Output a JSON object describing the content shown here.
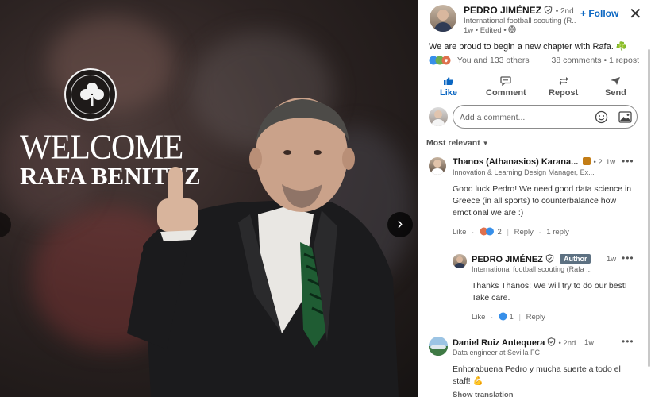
{
  "image": {
    "crest_text": "ΠΑΝΑΘΗΝΑΪΚΟΣ 1908",
    "welcome_text": "WELCOME",
    "name_text": "RAFA BENITEZ",
    "next_icon": "chevron-right-icon",
    "colors": {
      "club_green": "#1f5c33",
      "background": "#2a2221"
    }
  },
  "post": {
    "author": {
      "name": "PEDRO JIMÉNEZ",
      "degree": "• 2nd",
      "headline": "International football scouting (R...",
      "meta": "1w • Edited •"
    },
    "follow_label": "+ Follow",
    "close_icon": "close-icon",
    "text": "We are proud to begin a new chapter with Rafa. ☘️",
    "reactions_label": "You and 133 others",
    "comments_label": "38 comments",
    "reposts_label": "1 repost",
    "actions": {
      "like": "Like",
      "comment": "Comment",
      "repost": "Repost",
      "send": "Send"
    },
    "comment_placeholder": "Add a comment...",
    "sort_label": "Most relevant"
  },
  "comments": [
    {
      "name": "Thanos (Athanasios) Karana...",
      "degree": "• 2...",
      "headline": "Innovation & Learning Design Manager, Ex...",
      "time": "1w",
      "body": "Good luck Pedro! We need good data science in Greece (in all sports) to counterbalance how emotional we are :)",
      "like_label": "Like",
      "reaction_count": "2",
      "reply_label": "Reply",
      "replies_label": "1 reply"
    },
    {
      "name": "PEDRO JIMÉNEZ",
      "badge": "Author",
      "headline": "International football scouting (Rafa ...",
      "time": "1w",
      "body": "Thanks Thanos! We will try to do our best! Take care.",
      "like_label": "Like",
      "reaction_count": "1",
      "reply_label": "Reply"
    },
    {
      "name": "Daniel Ruiz Antequera",
      "degree": "• 2nd",
      "headline": "Data engineer at Sevilla FC",
      "time": "1w",
      "body": "Enhorabuena Pedro y mucha suerte a todo el staff! 💪",
      "translate_label": "Show translation"
    }
  ]
}
